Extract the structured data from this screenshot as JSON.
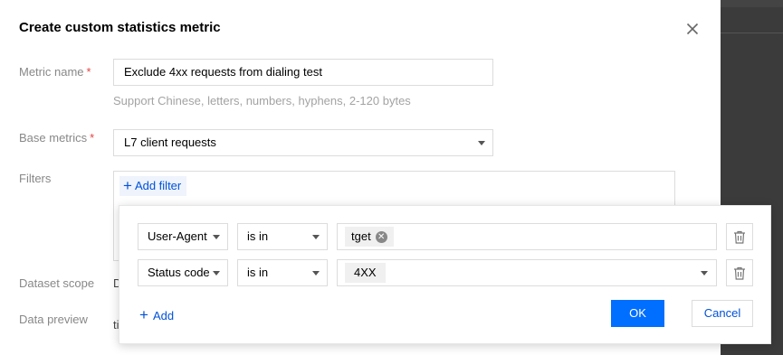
{
  "modal": {
    "title": "Create custom statistics metric",
    "metric_name": {
      "label": "Metric name",
      "required_mark": "*",
      "value": "Exclude 4xx requests from dialing test",
      "hint": "Support Chinese, letters, numbers, hyphens, 2-120 bytes"
    },
    "base_metrics": {
      "label": "Base metrics",
      "required_mark": "*",
      "value": "L7 client requests"
    },
    "filters": {
      "label": "Filters",
      "add_filter_label": "Add filter"
    },
    "dataset_scope": {
      "label": "Dataset scope",
      "partial_value": "D"
    },
    "data_preview": {
      "label": "Data preview",
      "partial_value": "ti"
    }
  },
  "filter_popover": {
    "rows": [
      {
        "field": "User-Agent",
        "operator": "is in",
        "value_tag": "tget"
      },
      {
        "field": "Status code",
        "operator": "is in",
        "value_tag": "4XX"
      }
    ],
    "add_label": "Add",
    "ok_label": "OK",
    "cancel_label": "Cancel"
  },
  "colors": {
    "primary": "#006eff",
    "link": "#0052d9",
    "required": "#e54545",
    "backdrop": "#3b3b3b"
  }
}
